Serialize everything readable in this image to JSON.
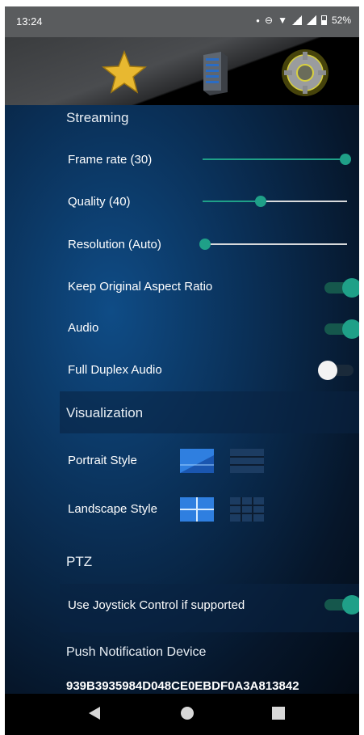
{
  "status": {
    "time": "13:24",
    "battery": "52%"
  },
  "sections": {
    "streaming": "Streaming",
    "visualization": "Visualization",
    "ptz": "PTZ",
    "push": "Push Notification Device"
  },
  "streaming": {
    "frame_rate_label": "Frame rate (30)",
    "frame_rate_level": 1.0,
    "quality_label": "Quality (40)",
    "quality_level": 0.4,
    "resolution_label": "Resolution (Auto)",
    "resolution_level": 0.0,
    "keep_aspect_label": "Keep Original Aspect Ratio",
    "keep_aspect_on": true,
    "audio_label": "Audio",
    "audio_on": true,
    "full_duplex_label": "Full Duplex Audio",
    "full_duplex_on": false
  },
  "visualization": {
    "portrait_label": "Portrait Style",
    "landscape_label": "Landscape Style"
  },
  "ptz": {
    "joystick_label": "Use Joystick Control if supported",
    "joystick_on": true
  },
  "push": {
    "device_id": "939B3935984D048CE0EBDF0A3A813842"
  },
  "icons": {
    "favorites": "star-icon",
    "server": "server-icon",
    "settings": "gear-icon",
    "back": "back-triangle-icon",
    "home": "home-circle-icon",
    "recents": "recents-square-icon"
  },
  "colors": {
    "accent": "#1fa088",
    "background": "#0a2f56"
  }
}
